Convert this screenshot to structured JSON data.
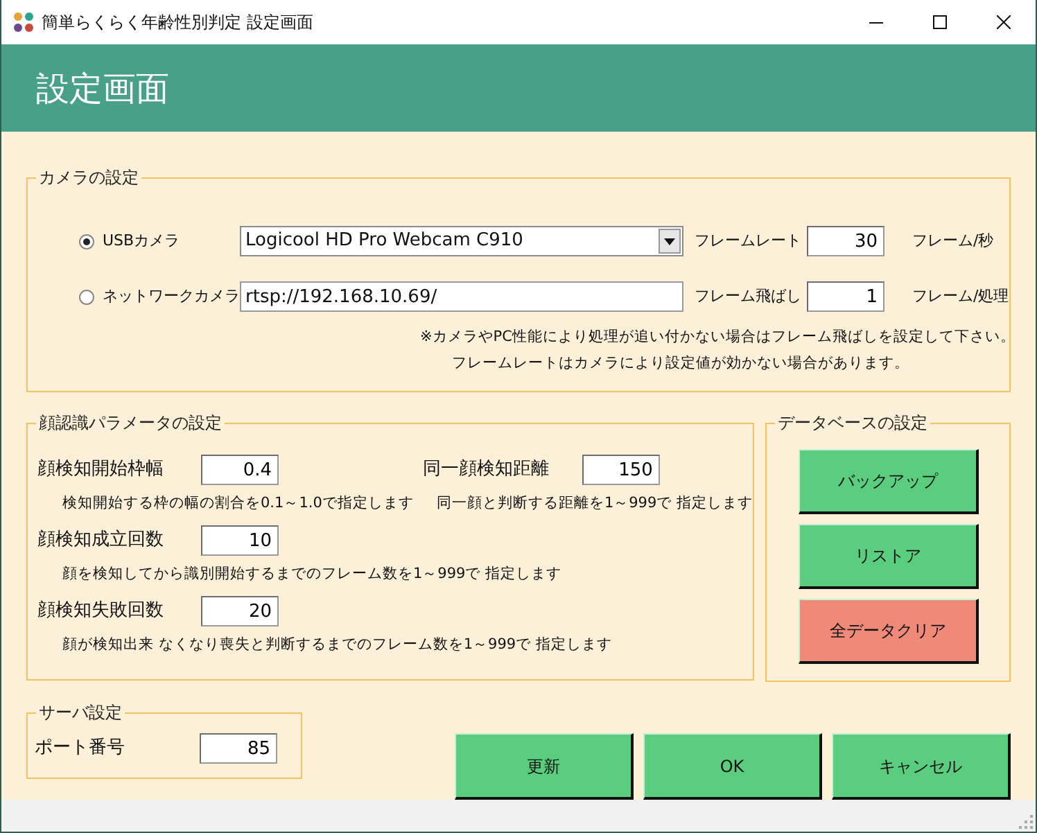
{
  "window": {
    "title": "簡単らくらく年齢性別判定 設定画面"
  },
  "header": {
    "title": "設定画面"
  },
  "camera": {
    "legend": "カメラの設定",
    "sources": [
      {
        "label": "USBカメラ",
        "selected": true,
        "kind": "dropdown",
        "value": "Logicool HD Pro Webcam C910",
        "setting_label": "フレームレート",
        "setting_value": "30",
        "setting_unit": "フレーム/秒"
      },
      {
        "label": "ネットワークカメラ",
        "selected": false,
        "kind": "text",
        "value": "rtsp://192.168.10.69/",
        "setting_label": "フレーム飛ばし",
        "setting_value": "1",
        "setting_unit": "フレーム/処理"
      }
    ],
    "notes": [
      "※カメラやPC性能により処理が追い付かない場合はフレーム飛ばしを設定して下さい。",
      "フレームレートはカメラにより設定値が効かない場合があります。"
    ]
  },
  "face": {
    "legend": "顔認識パラメータの設定",
    "params": [
      {
        "label": "顔検知開始枠幅",
        "value": "0.4",
        "hint": "検知開始する枠の幅の割合を0.1～1.0で指定します"
      },
      {
        "label": "同一顔検知距離",
        "value": "150",
        "hint": "同一顔と判断する距離を1～999で 指定します"
      },
      {
        "label": "顔検知成立回数",
        "value": "10",
        "hint": "顔を検知してから識別開始するまでのフレーム数を1～999で 指定します"
      },
      {
        "label": "顔検知失敗回数",
        "value": "20",
        "hint": "顔が検知出来 なくなり喪失と判断するまでのフレーム数を1～999で 指定します"
      }
    ]
  },
  "database": {
    "legend": "データベースの設定",
    "buttons": [
      {
        "label": "バックアップ",
        "kind": "normal"
      },
      {
        "label": "リストア",
        "kind": "normal"
      },
      {
        "label": "全データクリア",
        "kind": "danger"
      }
    ]
  },
  "server": {
    "legend": "サーバ設定",
    "port_label": "ポート番号",
    "port": "85"
  },
  "buttons": [
    "更新",
    "OK",
    "キャンセル"
  ]
}
